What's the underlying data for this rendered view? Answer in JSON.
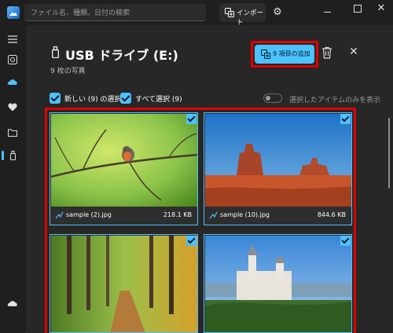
{
  "titlebar": {
    "search_placeholder": "ファイル名、種類、日付の検索",
    "import_label": "インポート",
    "icons": [
      "photos-app-icon",
      "import-icon",
      "gear-icon",
      "minimize-icon",
      "maximize-icon",
      "close-icon"
    ]
  },
  "nav": {
    "items": [
      "hamburger-icon",
      "gallery-icon",
      "onedrive-icon",
      "favorites-icon",
      "folders-icon",
      "usb-drive-icon",
      "icloud-icon"
    ],
    "active": "usb-drive-icon"
  },
  "header": {
    "title": "USB ドライブ (E:)",
    "photo_count": "9 枚の写真",
    "add_button": "9 項目の追加"
  },
  "selection": {
    "new_label": "新しい (9) の選択",
    "all_label": "すべて選択 (9)",
    "toggle_label": "選択したアイテムのみを表示",
    "toggle_on": false
  },
  "photos": [
    {
      "name": "sample (2).jpg",
      "size": "218.1 KB",
      "selected": true
    },
    {
      "name": "sample (10).jpg",
      "size": "844.6 KB",
      "selected": true
    },
    {
      "name": "",
      "size": "",
      "selected": true
    },
    {
      "name": "",
      "size": "",
      "selected": true
    }
  ],
  "colors": {
    "accent": "#4cc2ff",
    "highlight": "#e00000",
    "background": "#272727"
  }
}
